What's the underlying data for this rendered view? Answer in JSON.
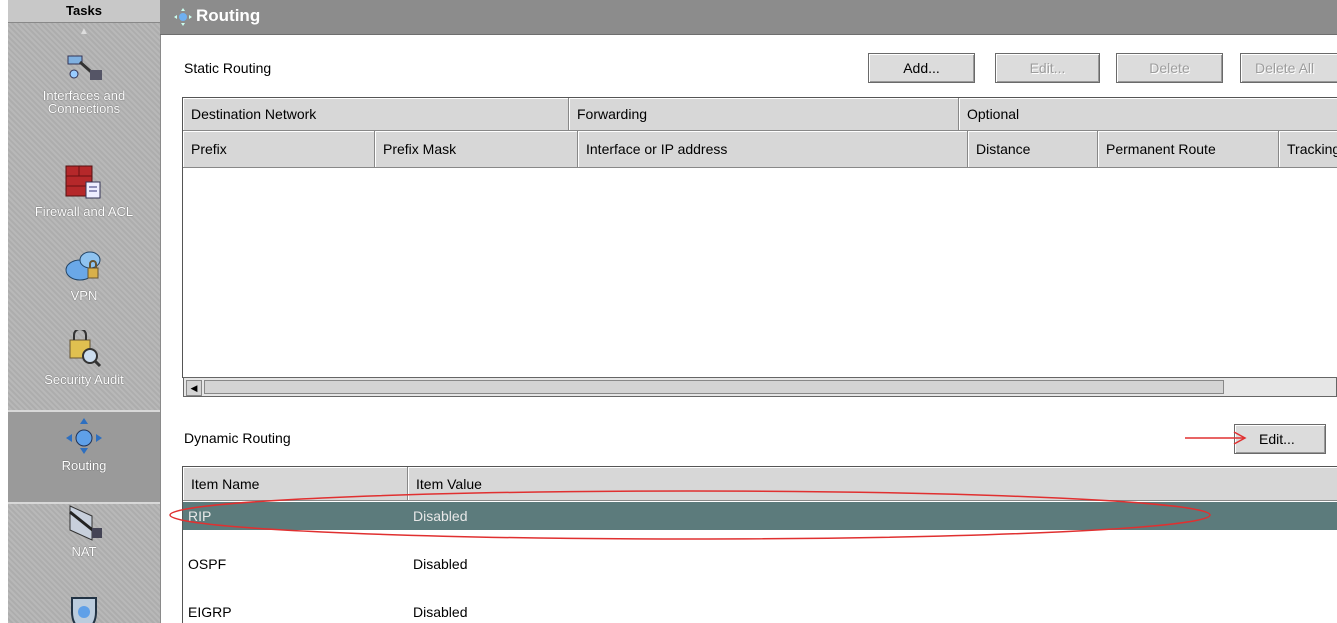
{
  "sidebar": {
    "header": "Tasks",
    "items": [
      {
        "label_line1": "Interfaces and",
        "label_line2": "Connections",
        "icon": "interfaces-icon"
      },
      {
        "label_line1": "Firewall and ACL",
        "label_line2": "",
        "icon": "firewall-icon"
      },
      {
        "label_line1": "VPN",
        "label_line2": "",
        "icon": "vpn-icon"
      },
      {
        "label_line1": "Security Audit",
        "label_line2": "",
        "icon": "security-audit-icon"
      },
      {
        "label_line1": "Routing",
        "label_line2": "",
        "icon": "routing-icon"
      },
      {
        "label_line1": "NAT",
        "label_line2": "",
        "icon": "nat-icon"
      },
      {
        "label_line1": "",
        "label_line2": "",
        "icon": "shield-icon"
      }
    ]
  },
  "page": {
    "title": "Routing"
  },
  "static_routing": {
    "label": "Static Routing",
    "buttons": {
      "add": "Add...",
      "edit": "Edit...",
      "delete": "Delete",
      "delete_all": "Delete All"
    },
    "group_headers": {
      "destination": "Destination Network",
      "forwarding": "Forwarding",
      "optional": "Optional"
    },
    "columns": {
      "prefix": "Prefix",
      "prefix_mask": "Prefix Mask",
      "interface": "Interface or IP address",
      "distance": "Distance",
      "permanent": "Permanent Route",
      "tracking": "Tracking"
    }
  },
  "dynamic_routing": {
    "label": "Dynamic Routing",
    "edit_button": "Edit...",
    "columns": {
      "name": "Item Name",
      "value": "Item Value"
    },
    "rows": [
      {
        "name": "RIP",
        "value": "Disabled"
      },
      {
        "name": "OSPF",
        "value": "Disabled"
      },
      {
        "name": "EIGRP",
        "value": "Disabled"
      }
    ],
    "selected_index": 0
  },
  "colors": {
    "selection": "#5c7b7c",
    "annotation": "#e03030"
  }
}
